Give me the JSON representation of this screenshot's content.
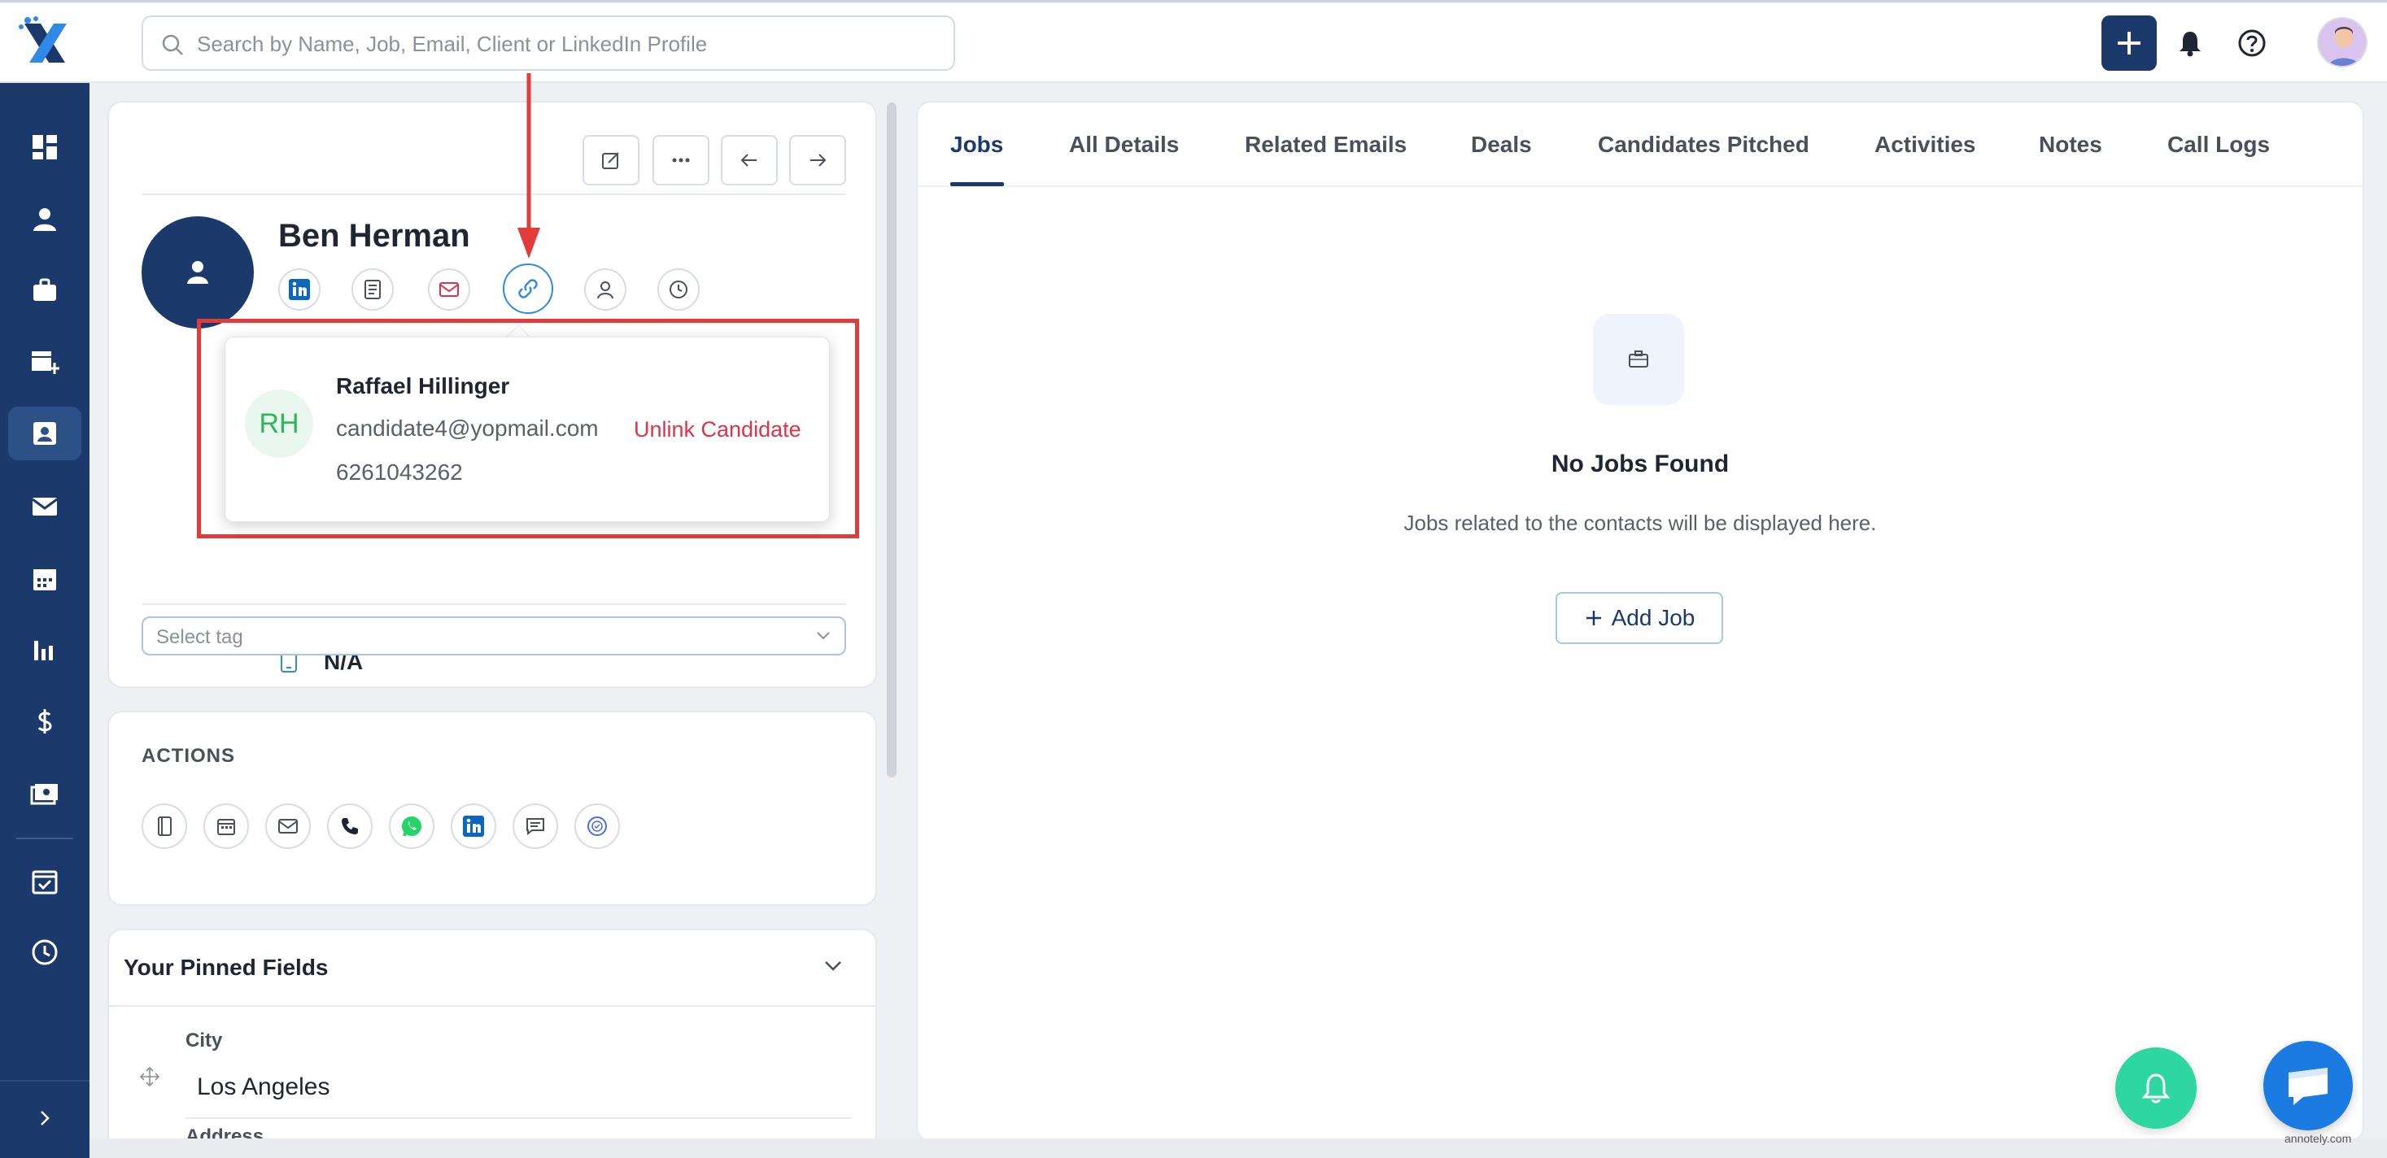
{
  "search": {
    "placeholder": "Search by Name, Job, Email, Client or LinkedIn Profile"
  },
  "sidebar": {
    "items": [
      {
        "icon": "dashboard-icon"
      },
      {
        "icon": "person-icon"
      },
      {
        "icon": "briefcase-icon"
      },
      {
        "icon": "store-add-icon"
      },
      {
        "icon": "contacts-icon",
        "active": true
      },
      {
        "icon": "mail-icon"
      },
      {
        "icon": "calendar-icon"
      },
      {
        "icon": "bar-chart-icon"
      },
      {
        "icon": "dollar-icon"
      },
      {
        "icon": "money-icon"
      },
      {
        "icon": "calendar-check-icon"
      },
      {
        "icon": "clock-icon"
      }
    ]
  },
  "profile": {
    "name": "Ben Herman",
    "phone_value": "N/A",
    "tag_placeholder": "Select tag"
  },
  "linked_candidate": {
    "initials": "RH",
    "name": "Raffael Hillinger",
    "email": "candidate4@yopmail.com",
    "phone": "6261043262",
    "unlink_label": "Unlink Candidate"
  },
  "actions": {
    "title": "ACTIONS"
  },
  "pinned": {
    "title": "Your Pinned Fields",
    "fields": [
      {
        "label": "City",
        "value": "Los Angeles"
      },
      {
        "label": "Address",
        "value": ""
      }
    ]
  },
  "tabs": [
    {
      "label": "Jobs",
      "active": true
    },
    {
      "label": "All Details"
    },
    {
      "label": "Related Emails"
    },
    {
      "label": "Deals"
    },
    {
      "label": "Candidates Pitched"
    },
    {
      "label": "Activities"
    },
    {
      "label": "Notes"
    },
    {
      "label": "Call Logs"
    }
  ],
  "empty_state": {
    "title": "No Jobs Found",
    "subtitle": "Jobs related to the contacts will be displayed here.",
    "button_label": "Add Job"
  },
  "watermark": "annotely.com",
  "colors": {
    "primary": "#1b3a6b",
    "accent_green": "#2ed6a0",
    "accent_blue": "#1c7be0",
    "danger": "#e0324b",
    "annotation_red": "#e23b3b"
  }
}
